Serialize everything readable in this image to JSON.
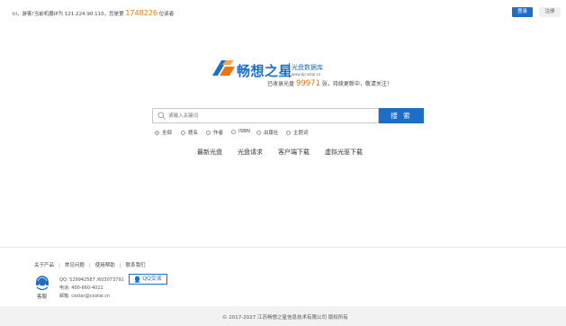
{
  "topbar": {
    "greeting_prefix": "hi，游客!当前机器IP为 121.224.90.110，您是第",
    "visitor_number": "1748226",
    "greeting_suffix": "位读者",
    "login_label": "登录",
    "register_label": "注册"
  },
  "brand": {
    "name": "畅想之星",
    "subtitle": "光盘数据库",
    "url": "www.bjcxstar.cn",
    "accent_color": "#1c6fc5",
    "highlight_color": "#e8760f"
  },
  "stats": {
    "prefix": "已收录光盘",
    "count": "99971",
    "suffix": "张，持续更新中，敬请关注！"
  },
  "search": {
    "placeholder": "请输入关键词",
    "button_label": "搜 索",
    "options": [
      "全部",
      "题名",
      "作者",
      "ISBN",
      "出版社",
      "主题词"
    ],
    "selected": "全部"
  },
  "nav": {
    "links": [
      "最新光盘",
      "光盘请求",
      "客户端下载",
      "虚拟光驱下载"
    ]
  },
  "footer": {
    "links": [
      "关于产品",
      "常见问题",
      "使用帮助",
      "联系我们"
    ],
    "service_label": "客服",
    "qq": "QQ: 529942587 /603073791",
    "phone": "电话: 400-660-4011",
    "email": "邮箱: cxstar@cxstar.cn",
    "qq_button_label": "QQ交谈",
    "copyright": "© 2017-2027   江苏畅想之星信息技术有限公司      版权所有"
  }
}
